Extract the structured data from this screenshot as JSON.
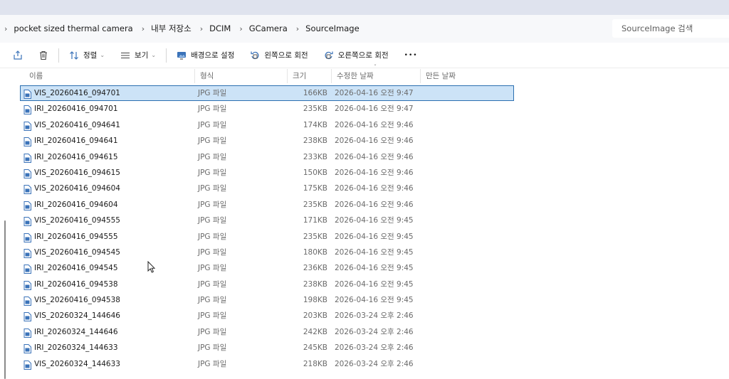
{
  "breadcrumb": {
    "items": [
      "pocket sized thermal camera",
      "내부 저장소",
      "DCIM",
      "GCamera",
      "SourceImage"
    ]
  },
  "search": {
    "placeholder": "SourceImage 검색"
  },
  "toolbar": {
    "share_icon": "share-icon",
    "delete_icon": "delete-icon",
    "sort_label": "정렬",
    "view_label": "보기",
    "background_label": "배경으로 설정",
    "rotate_left_label": "왼쪽으로 회전",
    "rotate_right_label": "오른쪽으로 회전",
    "more_label": "•••"
  },
  "columns": {
    "name": "이름",
    "type": "형식",
    "size": "크기",
    "modified": "수정한 날짜",
    "created": "만든 날짜"
  },
  "files": [
    {
      "name": "VIS_20260416_094701",
      "type": "JPG 파일",
      "size": "166KB",
      "modified": "2026-04-16 오전 9:47",
      "selected": true
    },
    {
      "name": "IRI_20260416_094701",
      "type": "JPG 파일",
      "size": "235KB",
      "modified": "2026-04-16 오전 9:47"
    },
    {
      "name": "VIS_20260416_094641",
      "type": "JPG 파일",
      "size": "174KB",
      "modified": "2026-04-16 오전 9:46"
    },
    {
      "name": "IRI_20260416_094641",
      "type": "JPG 파일",
      "size": "238KB",
      "modified": "2026-04-16 오전 9:46"
    },
    {
      "name": "IRI_20260416_094615",
      "type": "JPG 파일",
      "size": "233KB",
      "modified": "2026-04-16 오전 9:46"
    },
    {
      "name": "VIS_20260416_094615",
      "type": "JPG 파일",
      "size": "150KB",
      "modified": "2026-04-16 오전 9:46"
    },
    {
      "name": "VIS_20260416_094604",
      "type": "JPG 파일",
      "size": "175KB",
      "modified": "2026-04-16 오전 9:46"
    },
    {
      "name": "IRI_20260416_094604",
      "type": "JPG 파일",
      "size": "235KB",
      "modified": "2026-04-16 오전 9:46"
    },
    {
      "name": "VIS_20260416_094555",
      "type": "JPG 파일",
      "size": "171KB",
      "modified": "2026-04-16 오전 9:45"
    },
    {
      "name": "IRI_20260416_094555",
      "type": "JPG 파일",
      "size": "235KB",
      "modified": "2026-04-16 오전 9:45"
    },
    {
      "name": "VIS_20260416_094545",
      "type": "JPG 파일",
      "size": "180KB",
      "modified": "2026-04-16 오전 9:45"
    },
    {
      "name": "IRI_20260416_094545",
      "type": "JPG 파일",
      "size": "236KB",
      "modified": "2026-04-16 오전 9:45"
    },
    {
      "name": "IRI_20260416_094538",
      "type": "JPG 파일",
      "size": "238KB",
      "modified": "2026-04-16 오전 9:45"
    },
    {
      "name": "VIS_20260416_094538",
      "type": "JPG 파일",
      "size": "198KB",
      "modified": "2026-04-16 오전 9:45"
    },
    {
      "name": "VIS_20260324_144646",
      "type": "JPG 파일",
      "size": "203KB",
      "modified": "2026-03-24 오후 2:46"
    },
    {
      "name": "IRI_20260324_144646",
      "type": "JPG 파일",
      "size": "242KB",
      "modified": "2026-03-24 오후 2:46"
    },
    {
      "name": "IRI_20260324_144633",
      "type": "JPG 파일",
      "size": "245KB",
      "modified": "2026-03-24 오후 2:46"
    },
    {
      "name": "VIS_20260324_144633",
      "type": "JPG 파일",
      "size": "218KB",
      "modified": "2026-03-24 오후 2:46"
    }
  ],
  "colors": {
    "selection_bg": "#cce3f7",
    "selection_border": "#2c6fb0",
    "icon_blue": "#3b73b9"
  }
}
